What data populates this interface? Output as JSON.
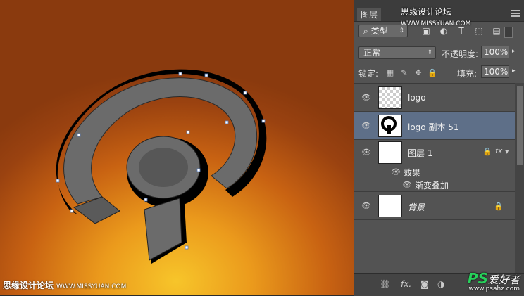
{
  "watermark": {
    "cn": "思缘设计论坛",
    "site": "WWW.MISSYUAN.COM",
    "ps_logo": "PS",
    "ps_cn": "爱好者",
    "ps_site": "www.psahz.com"
  },
  "panel": {
    "tab_label": "图层",
    "filter": {
      "kind_label": "类型",
      "search_symbol": "⌕"
    },
    "blend_mode": "正常",
    "opacity_label": "不透明度:",
    "opacity_value": "100%",
    "lock_label": "锁定:",
    "fill_label": "填充:",
    "fill_value": "100%"
  },
  "layers": [
    {
      "name": "logo",
      "visible": true
    },
    {
      "name": "logo 副本 51",
      "visible": true,
      "selected": true
    },
    {
      "name": "图层 1",
      "visible": true,
      "fx": "fx",
      "effects_label": "效果",
      "effect_item": "渐变叠加"
    },
    {
      "name": "背景",
      "visible": true,
      "locked": true
    }
  ],
  "colors": {
    "panel_bg": "#535353",
    "selected_row": "#5e6f88",
    "canvas_center": "#f7c52a",
    "canvas_edge": "#8a3a0e",
    "logo_face": "#6b6b6b"
  }
}
